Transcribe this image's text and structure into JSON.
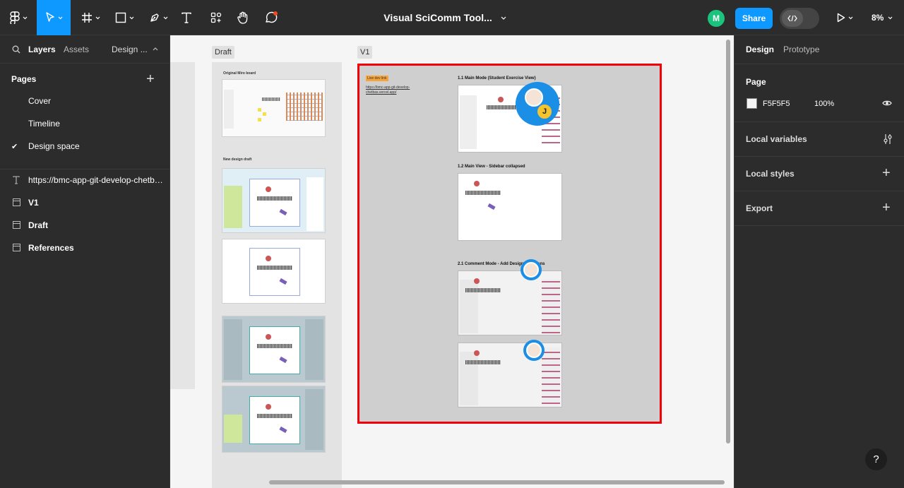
{
  "toolbar": {
    "doc_title": "Visual SciComm Tool...",
    "avatar_initial": "M",
    "share_label": "Share",
    "zoom": "8%"
  },
  "left_panel": {
    "tabs": {
      "layers": "Layers",
      "assets": "Assets",
      "design": "Design ..."
    },
    "pages_header": "Pages",
    "pages": [
      {
        "label": "Cover",
        "selected": false
      },
      {
        "label": "Timeline",
        "selected": false
      },
      {
        "label": "Design space",
        "selected": true
      }
    ],
    "selected_mark": "✔",
    "layers": [
      {
        "label": "https://bmc-app-git-develop-chetbas.vercel.app/",
        "icon": "text-icon"
      },
      {
        "label": "V1",
        "icon": "frame-icon"
      },
      {
        "label": "Draft",
        "icon": "frame-icon"
      },
      {
        "label": "References",
        "icon": "frame-icon"
      }
    ]
  },
  "canvas": {
    "draft_label": "Draft",
    "v1_label": "V1",
    "draft": {
      "original_title": "Original Miro board",
      "new_design_title": "New design draft"
    },
    "v1": {
      "live_tag": "Live dev link",
      "live_url": "https://bmc-app-git-develop-chetbas.vercel.app/",
      "shot_titles": [
        "1.1 Main Mode (Student Exercise View)",
        "1.2 Main View - Sidebar collapsed",
        "2.1 Comment Mode - Add Design Revisions"
      ],
      "collaborator_initial": "J"
    },
    "frame_highlight_color": "#f2000a"
  },
  "right_panel": {
    "tabs": {
      "design": "Design",
      "prototype": "Prototype"
    },
    "page_heading": "Page",
    "page_color": "F5F5F5",
    "page_opacity": "100%",
    "sections": [
      "Local variables",
      "Local styles",
      "Export"
    ],
    "help": "?"
  }
}
